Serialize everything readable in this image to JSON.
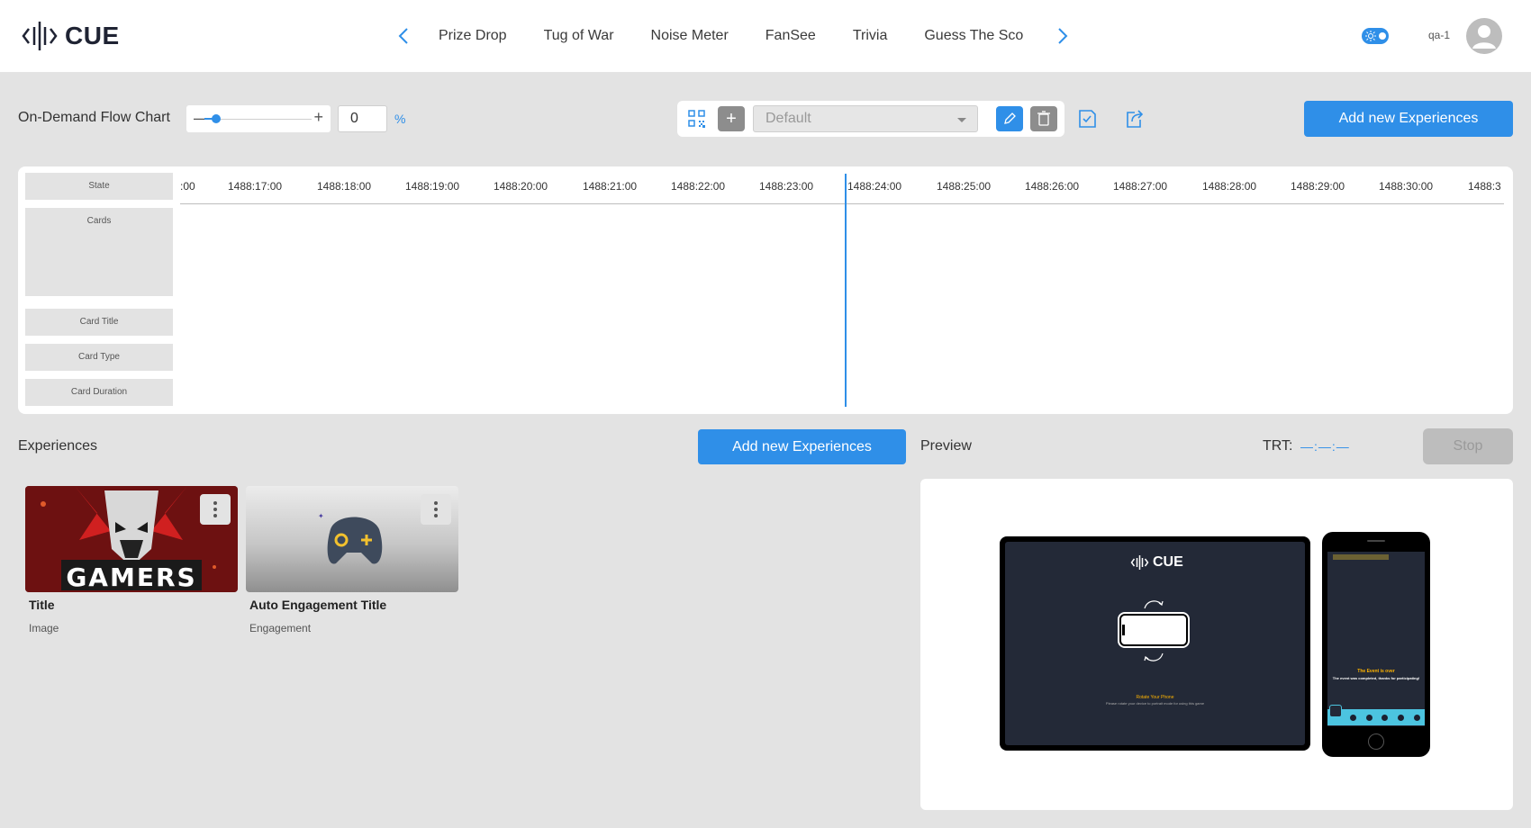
{
  "app": {
    "logo_text": "CUE",
    "brand_color": "#2f8fe8"
  },
  "nav": {
    "tabs": [
      {
        "label": "Prize Drop"
      },
      {
        "label": "Tug of War"
      },
      {
        "label": "Noise Meter"
      },
      {
        "label": "FanSee"
      },
      {
        "label": "Trivia"
      },
      {
        "label": "Guess The Sco"
      }
    ],
    "prev_icon": "chevron-left-icon",
    "next_icon": "chevron-right-icon"
  },
  "user": {
    "name": "qa-1",
    "theme_toggle_icon": "sun-icon"
  },
  "toolbar": {
    "flow_chart_label": "On-Demand Flow Chart",
    "zoom_value": "0",
    "zoom_unit": "%",
    "zoom_minus": "—",
    "zoom_plus": "+",
    "add_plus": "+",
    "preset_selected": "Default",
    "add_experiences_label": "Add new Experiences"
  },
  "timeline": {
    "row_labels": {
      "state": "State",
      "cards": "Cards",
      "card_title": "Card Title",
      "card_type": "Card Type",
      "card_duration": "Card Duration"
    },
    "ticks": [
      ":00",
      "1488:17:00",
      "1488:18:00",
      "1488:19:00",
      "1488:20:00",
      "1488:21:00",
      "1488:22:00",
      "1488:23:00",
      "1488:24:00",
      "1488:25:00",
      "1488:26:00",
      "1488:27:00",
      "1488:28:00",
      "1488:29:00",
      "1488:30:00",
      "1488:3"
    ]
  },
  "experiences": {
    "heading": "Experiences",
    "add_label": "Add new Experiences",
    "cards": [
      {
        "title": "Title",
        "type": "Image",
        "image_text": "GAMERS"
      },
      {
        "title": "Auto Engagement Title",
        "type": "Engagement"
      }
    ]
  },
  "preview": {
    "heading": "Preview",
    "trt_label": "TRT:",
    "trt_value": "—:—:—",
    "stop_label": "Stop",
    "tablet": {
      "logo_text": "CUE",
      "title": "Rotate Your Phone",
      "subtitle": "Please rotate your device to portrait mode for using this game"
    },
    "phone": {
      "title": "The Event is over",
      "subtitle": "The event was completed, thanks for participating!"
    }
  }
}
